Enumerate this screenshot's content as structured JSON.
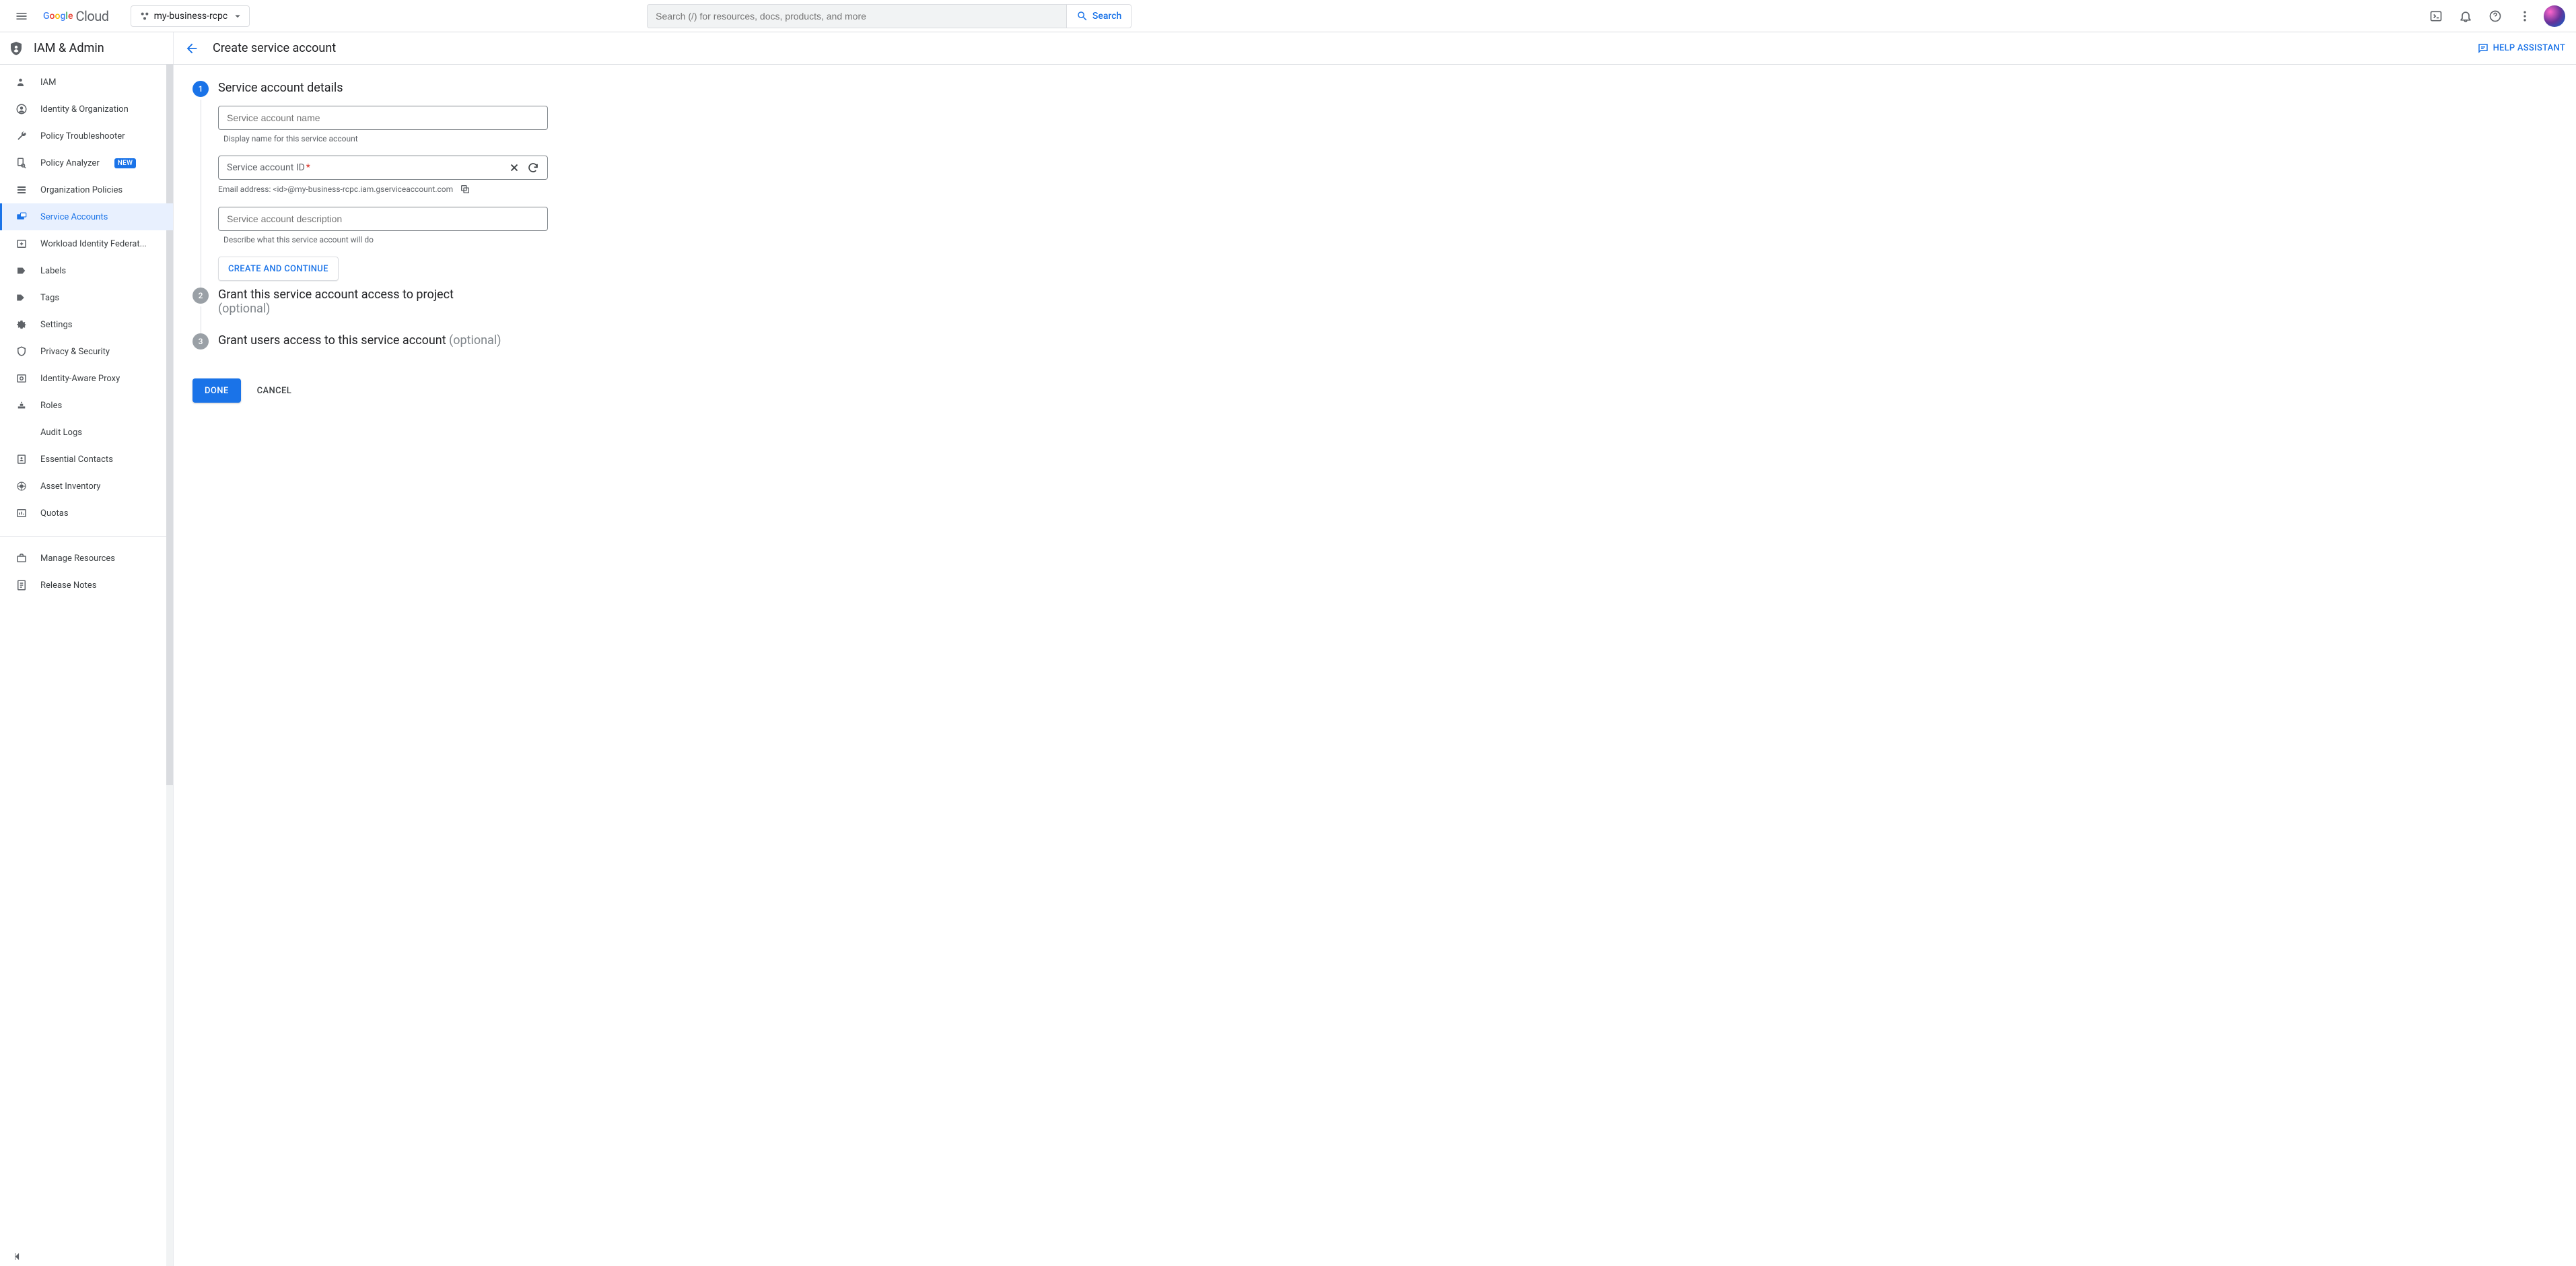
{
  "topbar": {
    "logo_cloud": "Cloud",
    "project": "my-business-rcpc",
    "search_placeholder": "Search (/) for resources, docs, products, and more",
    "search_button": "Search"
  },
  "section": {
    "title": "IAM & Admin",
    "page_title": "Create service account",
    "help_assistant": "HELP ASSISTANT"
  },
  "sidebar": {
    "items": [
      {
        "label": "IAM"
      },
      {
        "label": "Identity & Organization"
      },
      {
        "label": "Policy Troubleshooter"
      },
      {
        "label": "Policy Analyzer",
        "badge": "NEW"
      },
      {
        "label": "Organization Policies"
      },
      {
        "label": "Service Accounts"
      },
      {
        "label": "Workload Identity Federat..."
      },
      {
        "label": "Labels"
      },
      {
        "label": "Tags"
      },
      {
        "label": "Settings"
      },
      {
        "label": "Privacy & Security"
      },
      {
        "label": "Identity-Aware Proxy"
      },
      {
        "label": "Roles"
      },
      {
        "label": "Audit Logs"
      },
      {
        "label": "Essential Contacts"
      },
      {
        "label": "Asset Inventory"
      },
      {
        "label": "Quotas"
      }
    ],
    "footer": [
      {
        "label": "Manage Resources"
      },
      {
        "label": "Release Notes"
      }
    ]
  },
  "stepper": {
    "steps": [
      {
        "num": "1",
        "title": "Service account details"
      },
      {
        "num": "2",
        "title": "Grant this service account access to project",
        "optional": "(optional)"
      },
      {
        "num": "3",
        "title": "Grant users access to this service account ",
        "optional": "(optional)"
      }
    ],
    "fields": {
      "name_placeholder": "Service account name",
      "name_helper": "Display name for this service account",
      "id_placeholder": "Service account ID",
      "email_prefix": "Email address: ",
      "email_value": "<id>@my-business-rcpc.iam.gserviceaccount.com",
      "desc_placeholder": "Service account description",
      "desc_helper": "Describe what this service account will do"
    },
    "buttons": {
      "create_continue": "CREATE AND CONTINUE",
      "done": "DONE",
      "cancel": "CANCEL"
    }
  }
}
